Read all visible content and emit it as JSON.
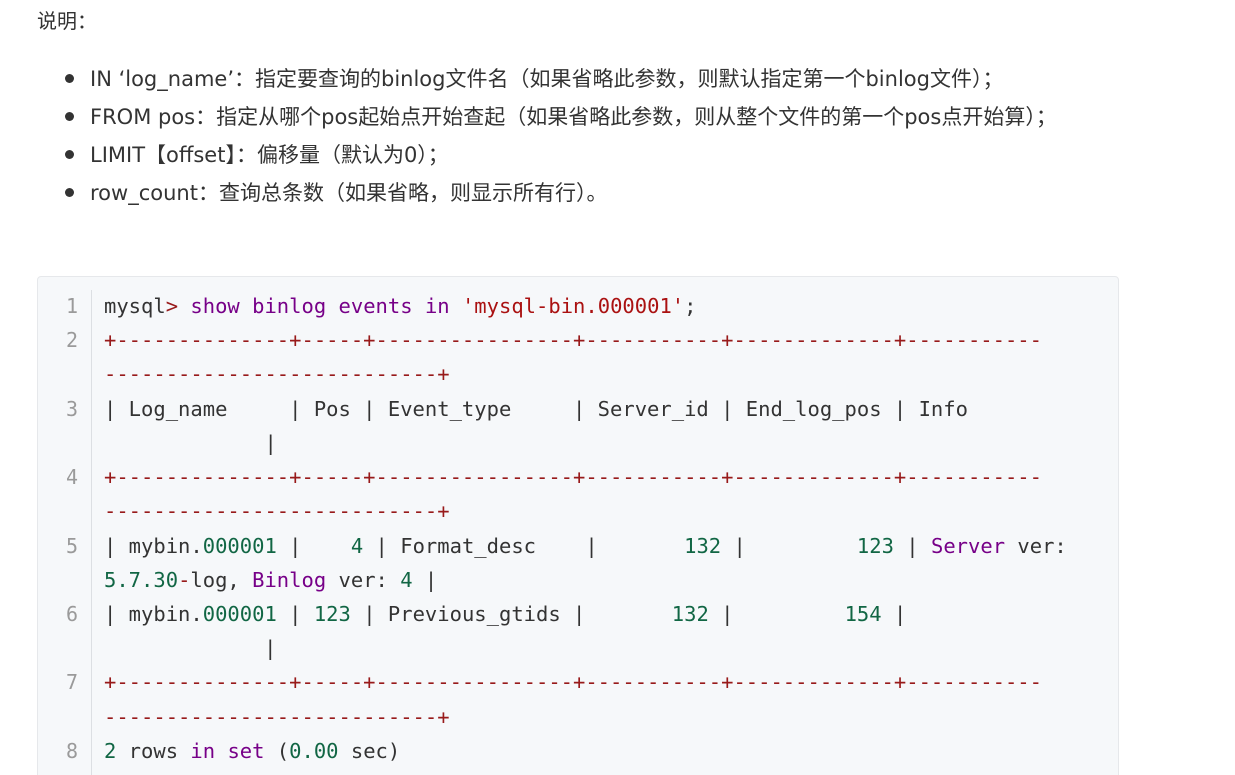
{
  "intro": "说明：",
  "bullets": [
    "IN ‘log_name’：指定要查询的binlog文件名（如果省略此参数，则默认指定第一个binlog文件）；",
    "FROM pos：指定从哪个pos起始点开始查起（如果省略此参数，则从整个文件的第一个pos点开始算）；",
    "LIMIT【offset】：偏移量（默认为0）；",
    "row_count：查询总条数（如果省略，则显示所有行）。"
  ],
  "code": {
    "line_numbers": [
      "1",
      "2",
      "3",
      "4",
      "5",
      "6",
      "7",
      "8"
    ],
    "line1": {
      "prompt": "mysql",
      "gt": ">",
      "show": "show",
      "binlog": "binlog",
      "events": "events",
      "in": "in",
      "file": "'mysql-bin.000001'",
      "semi": ";"
    },
    "border_a": "+--------------+-----+----------------+-----------+-------------+-----------",
    "border_b": "---------------------------+",
    "header_a": "| Log_name     | Pos | Event_type     | Server_id | End_log_pos | Info",
    "header_b": "             |",
    "row1": {
      "p1": "| mybin.",
      "n1": "000001",
      "p2": " |    ",
      "n2": "4",
      "p3": " | Format_desc    |       ",
      "n3": "132",
      "p4": " |         ",
      "n4": "123",
      "p5": " | ",
      "k1": "Server",
      "p6": " ver:",
      "n5": "5.7.30",
      "m1": "-",
      "p7": "log, ",
      "k2": "Binlog",
      "p8": " ver: ",
      "n6": "4",
      "p9": " |"
    },
    "row2": {
      "p1": "| mybin.",
      "n1": "000001",
      "p2": " | ",
      "n2": "123",
      "p3": " | Previous_gtids |       ",
      "n3": "132",
      "p4": " |         ",
      "n4": "154",
      "p5": " |",
      "wrap": "            |"
    },
    "line8": {
      "n1": "2",
      "p1": " rows ",
      "k1": "in",
      "p2": " ",
      "k2": "set",
      "p3": " (",
      "n2": "0.00",
      "p4": " sec)"
    }
  }
}
